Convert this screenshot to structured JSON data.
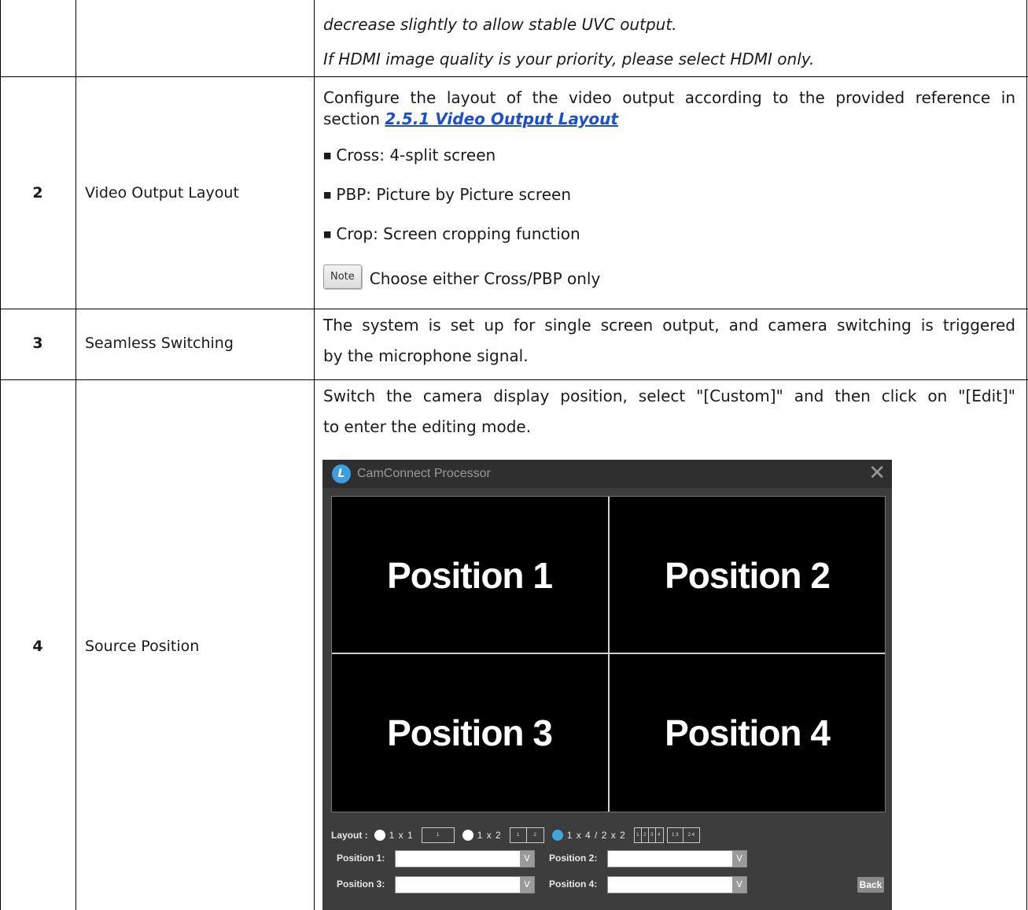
{
  "rows": [
    {
      "lines": [
        "decrease slightly to allow stable UVC output.",
        "If HDMI image quality is your priority, please select HDMI only."
      ]
    },
    {
      "number": "2",
      "item": "Video Output Layout",
      "intro_1": "Configure the layout of the video output according to the provided reference in",
      "intro_2_prefix": "section ",
      "intro_link": "2.5.1 Video Output Layout",
      "bullets": [
        "Cross: 4-split screen",
        "PBP: Picture by Picture screen",
        "Crop: Screen cropping function"
      ],
      "note_badge": "Note",
      "note_text": "Choose either Cross/PBP only"
    },
    {
      "number": "3",
      "item": "Seamless Switching",
      "line_1": "The system is set up for single screen output, and camera switching is triggered",
      "line_2": "by the microphone signal."
    },
    {
      "number": "4",
      "item": "Source Position",
      "line_1": "Switch the camera display position, select \"[Custom]\" and then click on \"[Edit]\"",
      "line_2": "to enter the editing mode."
    }
  ],
  "app": {
    "logo_letter": "L",
    "title": "CamConnect Processor",
    "close_glyph": "✕",
    "panes": [
      "Position 1",
      "Position 2",
      "Position 3",
      "Position 4"
    ],
    "layout_label": "Layout :",
    "layout_options": [
      {
        "label": "1 x 1",
        "selected": false
      },
      {
        "label": "1 x 2",
        "selected": false
      },
      {
        "label": "1 x 4 / 2 x 2",
        "selected": true
      }
    ],
    "position_labels": [
      "Position 1:",
      "Position 2:",
      "Position 3:",
      "Position 4:"
    ],
    "back_label": "Back",
    "accent_color": "#3aa9d8"
  }
}
